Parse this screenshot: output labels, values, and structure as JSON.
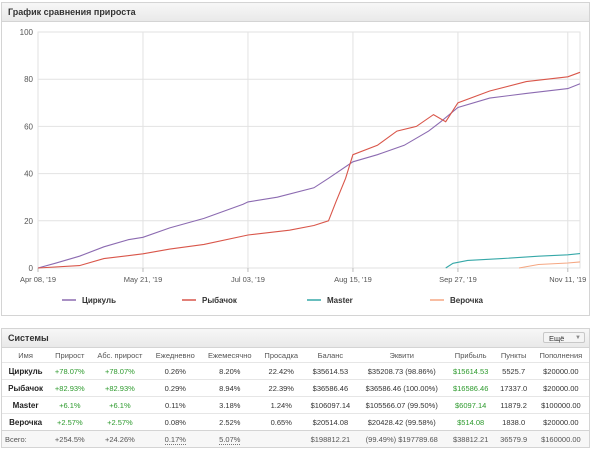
{
  "chart_panel": {
    "title": "График сравнения прироста"
  },
  "systems_panel": {
    "title": "Системы",
    "more_label": "Ещё"
  },
  "chart_data": {
    "type": "line",
    "title": "",
    "xlabel": "",
    "ylabel": "",
    "ylim": [
      0,
      100
    ],
    "yticks": [
      0,
      20,
      40,
      60,
      80,
      100
    ],
    "xlim": [
      "2019-04-08",
      "2019-11-16"
    ],
    "xticks": [
      {
        "date": "2019-04-08",
        "label": "Apr 08, '19"
      },
      {
        "date": "2019-05-21",
        "label": "May 21, '19"
      },
      {
        "date": "2019-07-03",
        "label": "Jul 03, '19"
      },
      {
        "date": "2019-08-15",
        "label": "Aug 15, '19"
      },
      {
        "date": "2019-09-27",
        "label": "Sep 27, '19"
      },
      {
        "date": "2019-11-11",
        "label": "Nov 11, '19"
      }
    ],
    "grid": true,
    "legend_position": "bottom",
    "series": [
      {
        "name": "Циркуль",
        "color": "#8c6bb1",
        "points": [
          [
            "2019-04-08",
            0
          ],
          [
            "2019-04-15",
            2
          ],
          [
            "2019-04-25",
            5
          ],
          [
            "2019-05-05",
            9
          ],
          [
            "2019-05-15",
            12
          ],
          [
            "2019-05-21",
            13
          ],
          [
            "2019-06-01",
            17
          ],
          [
            "2019-06-15",
            21
          ],
          [
            "2019-07-01",
            27
          ],
          [
            "2019-07-03",
            28
          ],
          [
            "2019-07-15",
            30
          ],
          [
            "2019-07-30",
            34
          ],
          [
            "2019-08-05",
            38
          ],
          [
            "2019-08-15",
            45
          ],
          [
            "2019-08-25",
            48
          ],
          [
            "2019-09-05",
            52
          ],
          [
            "2019-09-15",
            58
          ],
          [
            "2019-09-20",
            62
          ],
          [
            "2019-09-27",
            68
          ],
          [
            "2019-10-10",
            72
          ],
          [
            "2019-10-25",
            74
          ],
          [
            "2019-11-11",
            76
          ],
          [
            "2019-11-16",
            78.07
          ]
        ]
      },
      {
        "name": "Рыбачок",
        "color": "#d9564a",
        "points": [
          [
            "2019-04-08",
            0
          ],
          [
            "2019-04-25",
            1
          ],
          [
            "2019-05-05",
            4
          ],
          [
            "2019-05-21",
            6
          ],
          [
            "2019-06-01",
            8
          ],
          [
            "2019-06-15",
            10
          ],
          [
            "2019-07-03",
            14
          ],
          [
            "2019-07-20",
            16
          ],
          [
            "2019-07-30",
            18
          ],
          [
            "2019-08-05",
            20
          ],
          [
            "2019-08-08",
            28
          ],
          [
            "2019-08-12",
            38
          ],
          [
            "2019-08-15",
            48
          ],
          [
            "2019-08-25",
            52
          ],
          [
            "2019-09-02",
            58
          ],
          [
            "2019-09-10",
            60
          ],
          [
            "2019-09-17",
            65
          ],
          [
            "2019-09-22",
            62
          ],
          [
            "2019-09-27",
            70
          ],
          [
            "2019-10-10",
            75
          ],
          [
            "2019-10-25",
            79
          ],
          [
            "2019-11-11",
            81
          ],
          [
            "2019-11-16",
            82.93
          ]
        ]
      },
      {
        "name": "Master",
        "color": "#36a8a8",
        "points": [
          [
            "2019-09-22",
            0
          ],
          [
            "2019-09-25",
            2
          ],
          [
            "2019-10-01",
            3.2
          ],
          [
            "2019-10-15",
            4
          ],
          [
            "2019-10-30",
            5
          ],
          [
            "2019-11-11",
            5.6
          ],
          [
            "2019-11-16",
            6.1
          ]
        ]
      },
      {
        "name": "Верочка",
        "color": "#f5a782",
        "points": [
          [
            "2019-10-22",
            0
          ],
          [
            "2019-10-30",
            1.5
          ],
          [
            "2019-11-11",
            2.1
          ],
          [
            "2019-11-16",
            2.57
          ]
        ]
      }
    ]
  },
  "table": {
    "headers": [
      "Имя",
      "Прирост",
      "Абс. прирост",
      "Ежедневно",
      "Ежемесячно",
      "Просадка",
      "Баланс",
      "Эквити",
      "Прибыль",
      "Пункты",
      "Пополнения"
    ],
    "rows": [
      {
        "name": "Циркуль",
        "gain": "+78.07%",
        "abs_gain": "+78.07%",
        "daily": "0.26%",
        "monthly": "8.20%",
        "drawdown": "22.42%",
        "balance": "$35614.53",
        "equity": "$35208.73 (98.86%)",
        "profit": "$15614.53",
        "pips": "5525.7",
        "deposits": "$20000.00"
      },
      {
        "name": "Рыбачок",
        "gain": "+82.93%",
        "abs_gain": "+82.93%",
        "daily": "0.29%",
        "monthly": "8.94%",
        "drawdown": "22.39%",
        "balance": "$36586.46",
        "equity": "$36586.46 (100.00%)",
        "profit": "$16586.46",
        "pips": "17337.0",
        "deposits": "$20000.00"
      },
      {
        "name": "Master",
        "gain": "+6.1%",
        "abs_gain": "+6.1%",
        "daily": "0.11%",
        "monthly": "3.18%",
        "drawdown": "1.24%",
        "balance": "$106097.14",
        "equity": "$105566.07 (99.50%)",
        "profit": "$6097.14",
        "pips": "11879.2",
        "deposits": "$100000.00"
      },
      {
        "name": "Верочка",
        "gain": "+2.57%",
        "abs_gain": "+2.57%",
        "daily": "0.08%",
        "monthly": "2.52%",
        "drawdown": "0.65%",
        "balance": "$20514.08",
        "equity": "$20428.42 (99.58%)",
        "profit": "$514.08",
        "pips": "1838.0",
        "deposits": "$20000.00"
      }
    ],
    "total": {
      "name": "Всего:",
      "gain": "+254.5%",
      "abs_gain": "+24.26%",
      "daily": "0.17%",
      "monthly": "5.07%",
      "drawdown": "",
      "balance": "$198812.21",
      "equity": "(99.49%) $197789.68",
      "profit": "$38812.21",
      "pips": "36579.9",
      "deposits": "$160000.00"
    }
  }
}
